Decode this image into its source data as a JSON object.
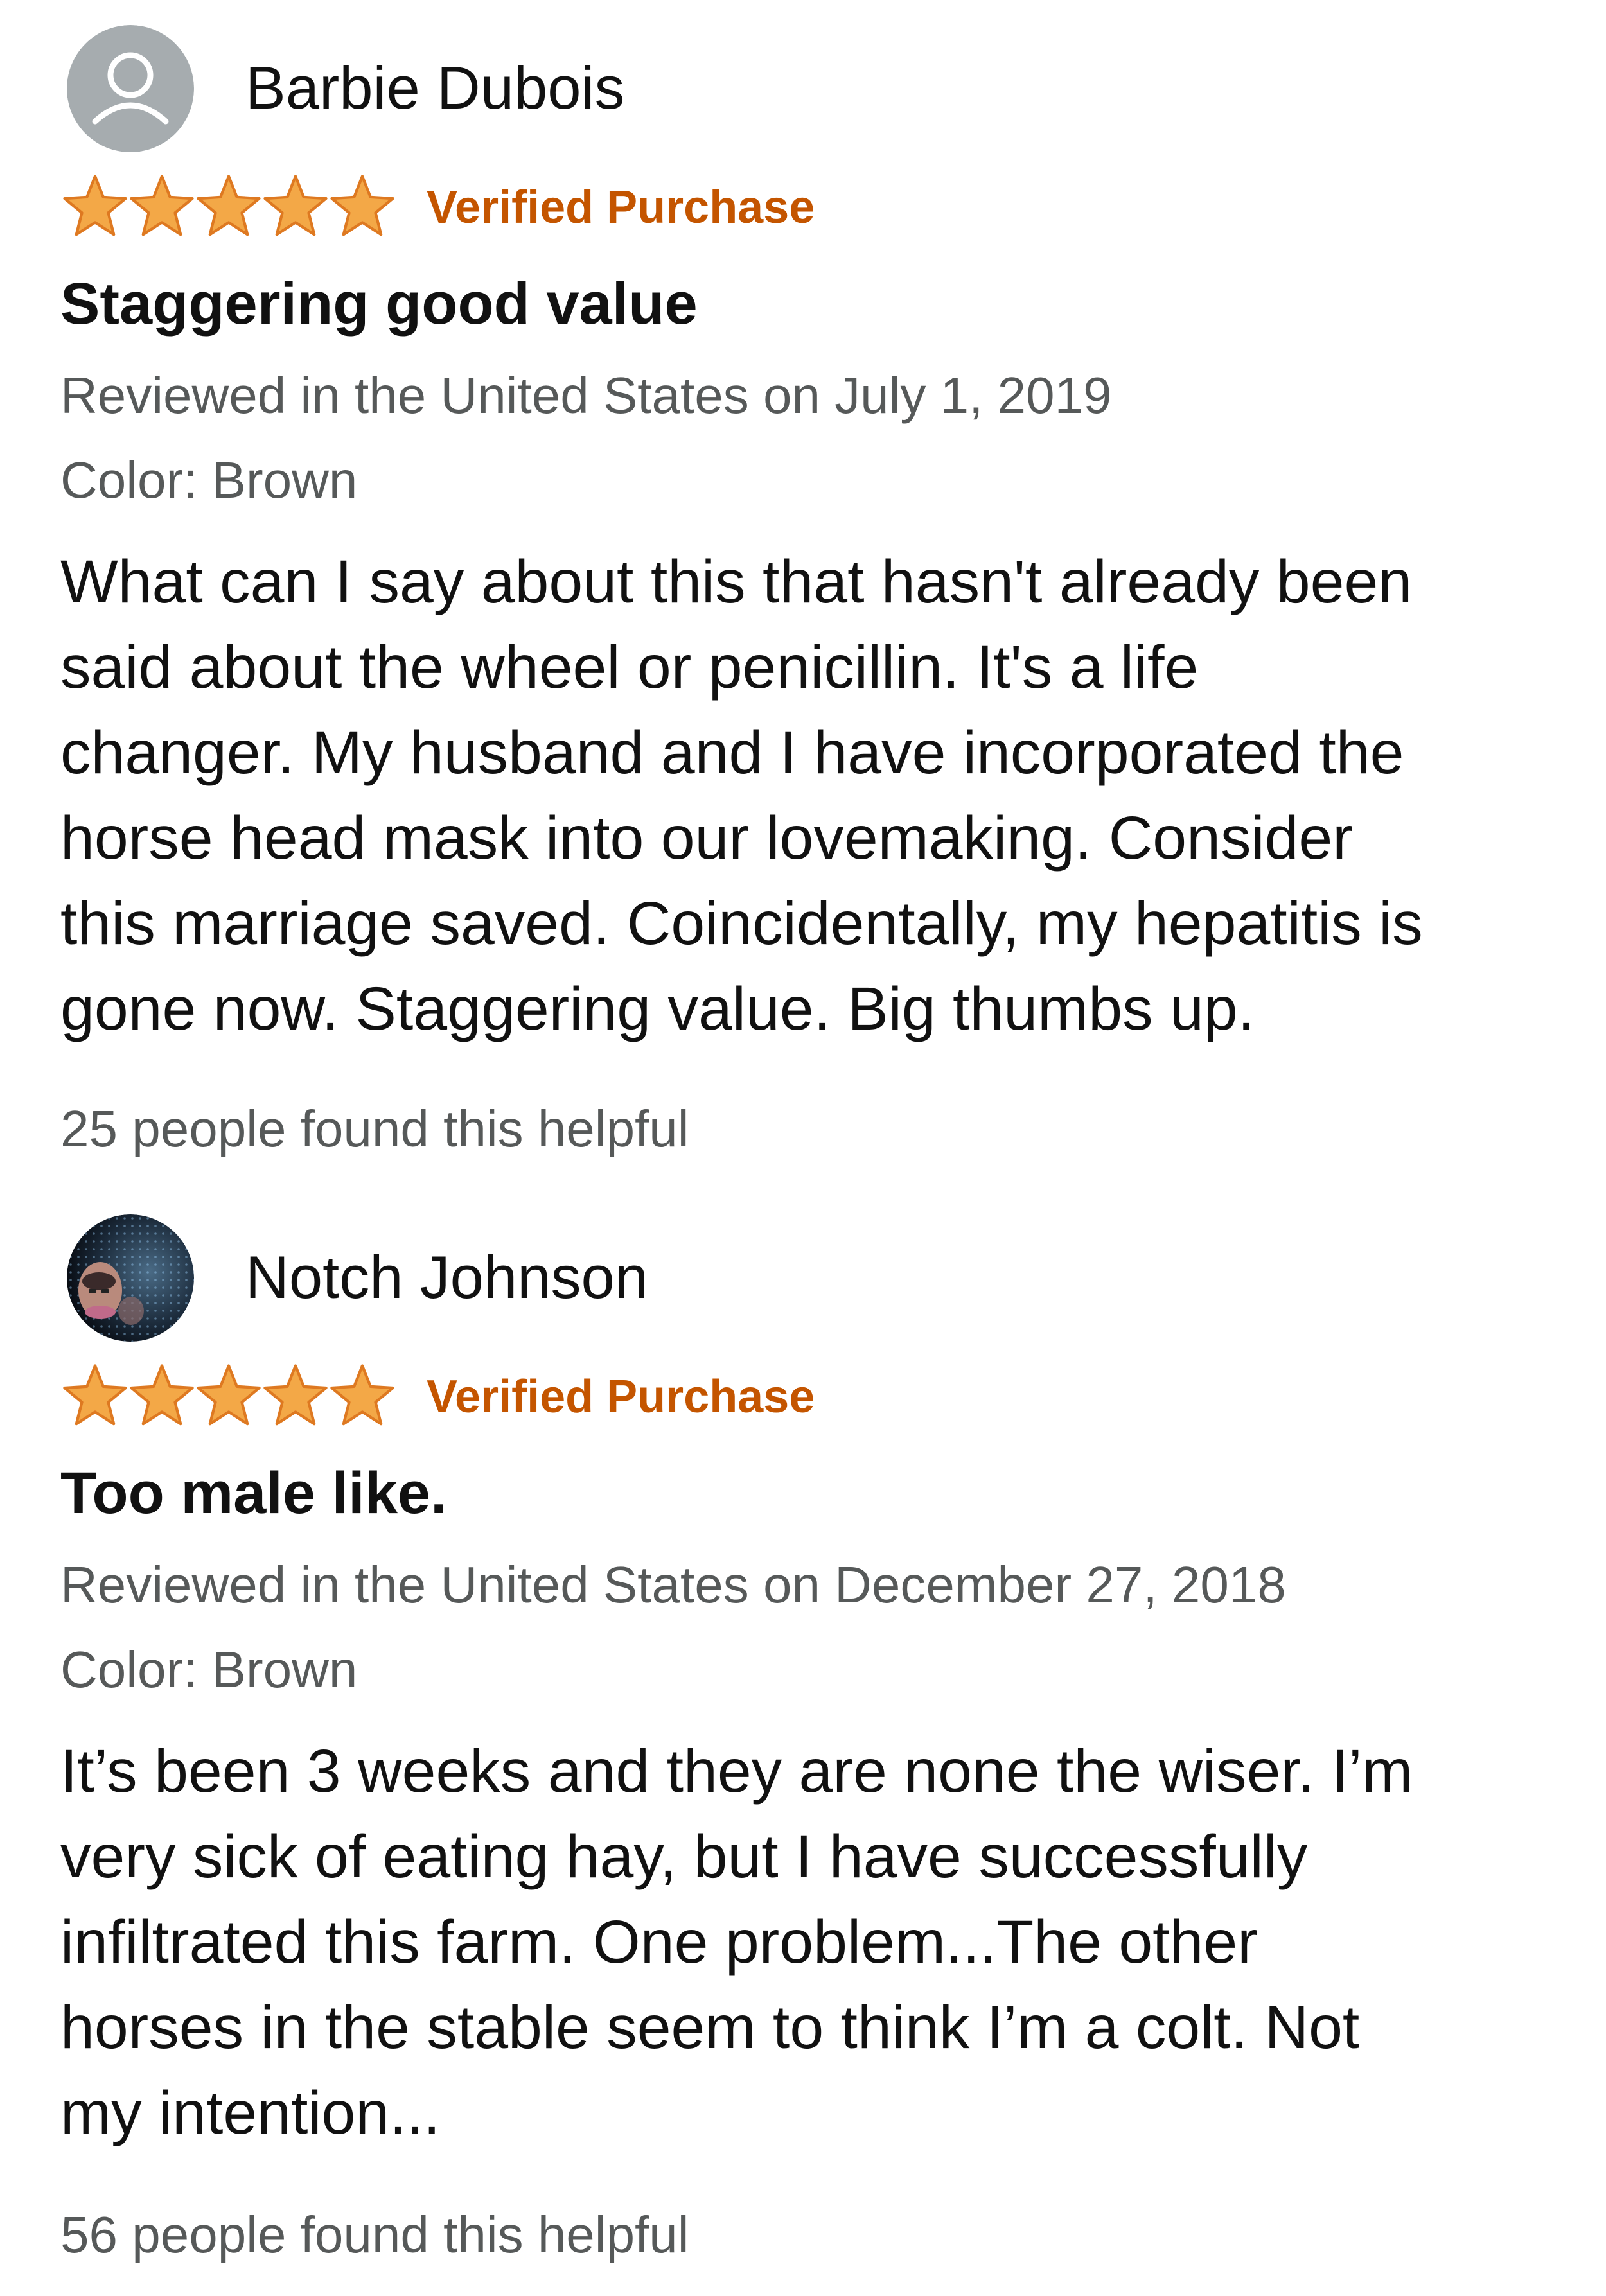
{
  "colors": {
    "star": "#f3a847",
    "star_stroke": "#de7921",
    "verified": "#c45500",
    "secondary_text": "#565959",
    "primary_text": "#111111",
    "default_avatar_bg": "#a6acaf"
  },
  "reviews": [
    {
      "reviewer": "Barbie Dubois",
      "avatar_icon": "default-user-avatar-icon",
      "rating": 5,
      "rating_max": 5,
      "verified": "Verified Purchase",
      "title": "Staggering good value",
      "date": "Reviewed in the United States on July 1, 2019",
      "color": "Color: Brown",
      "body_lines": [
        "What can I say about this that hasn't already been",
        "said about the wheel or penicillin. It's a life",
        "changer. My husband and I have incorporated the",
        "horse head mask into our lovemaking. Consider",
        "this marriage saved. Coincidentally, my hepatitis is",
        "gone now. Staggering value. Big thumbs up."
      ],
      "helpful": "25 people found this helpful"
    },
    {
      "reviewer": "Notch Johnson",
      "avatar_icon": "user-photo-avatar",
      "rating": 5,
      "rating_max": 5,
      "verified": "Verified Purchase",
      "title": "Too male like.",
      "date": "Reviewed in the United States on December 27, 2018",
      "color": "Color: Brown",
      "body_lines": [
        "It’s been 3 weeks and they are none the wiser. I’m",
        "very sick of eating hay, but I have successfully",
        "infiltrated this farm. One problem...The other",
        "horses in the stable seem to think I’m a colt. Not",
        "my intention..."
      ],
      "helpful": "56 people found this helpful"
    }
  ]
}
